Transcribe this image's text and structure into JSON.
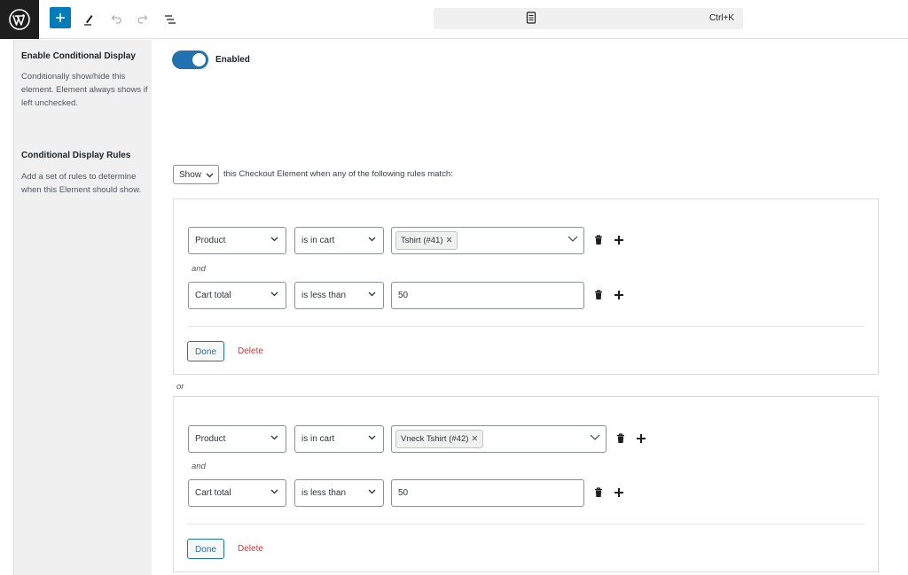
{
  "toolbar": {
    "logo_icon": "wordpress-logo",
    "add_icon": "plus-icon",
    "edit_icon": "pencil-icon",
    "undo_icon": "undo-icon",
    "redo_icon": "redo-icon",
    "outline_icon": "list-view-icon",
    "command_icon": "document-icon",
    "command_shortcut": "Ctrl+K",
    "accent_color": "#007cba"
  },
  "options": [
    {
      "title": "Enable Conditional Display",
      "description": "Conditionally show/hide this element. Element always shows if left unchecked."
    },
    {
      "title": "Conditional Display Rules",
      "description": "Add a set of rules to determine when this Element should show."
    }
  ],
  "toggle": {
    "state": "on",
    "label": "Enabled",
    "color": "#2271b1"
  },
  "rules": {
    "action_select": "Show",
    "sentence": "this Checkout Element when any of the following rules match:",
    "or_label": "or",
    "groups": [
      {
        "conditions": [
          {
            "field": "Product",
            "operator": "is in cart",
            "value_tag": "Tshirt (#41)"
          },
          {
            "field": "Cart total",
            "operator": "is less than",
            "value": "50"
          }
        ],
        "and_label": "and",
        "done_label": "Done",
        "delete_label": "Delete"
      },
      {
        "conditions": [
          {
            "field": "Product",
            "operator": "is in cart",
            "value_tag": "Vneck Tshirt (#42)"
          },
          {
            "field": "Cart total",
            "operator": "is less than",
            "value": "50"
          }
        ],
        "and_label": "and",
        "done_label": "Done",
        "delete_label": "Delete"
      }
    ]
  }
}
